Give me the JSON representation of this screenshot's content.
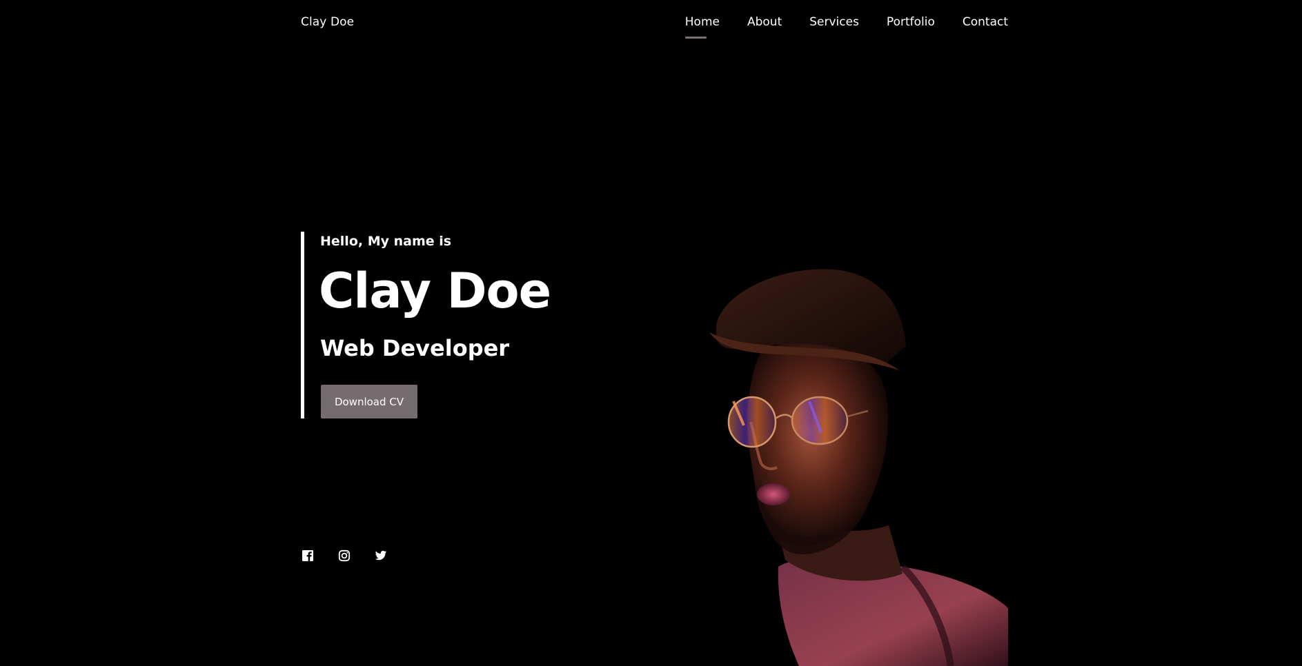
{
  "header": {
    "logo": "Clay Doe",
    "nav": [
      {
        "label": "Home",
        "active": true
      },
      {
        "label": "About",
        "active": false
      },
      {
        "label": "Services",
        "active": false
      },
      {
        "label": "Portfolio",
        "active": false
      },
      {
        "label": "Contact",
        "active": false
      }
    ]
  },
  "hero": {
    "greeting": "Hello, My name is",
    "name": "Clay Doe",
    "role": "Web Developer",
    "button_label": "Download CV"
  },
  "socials": [
    {
      "icon": "facebook-icon"
    },
    {
      "icon": "instagram-icon"
    },
    {
      "icon": "twitter-icon"
    }
  ],
  "portrait": {
    "subject": "man with cap and glasses in pink-orange neon light"
  },
  "colors": {
    "background": "#000000",
    "text": "#ffffff",
    "accent": "#766b6f"
  }
}
